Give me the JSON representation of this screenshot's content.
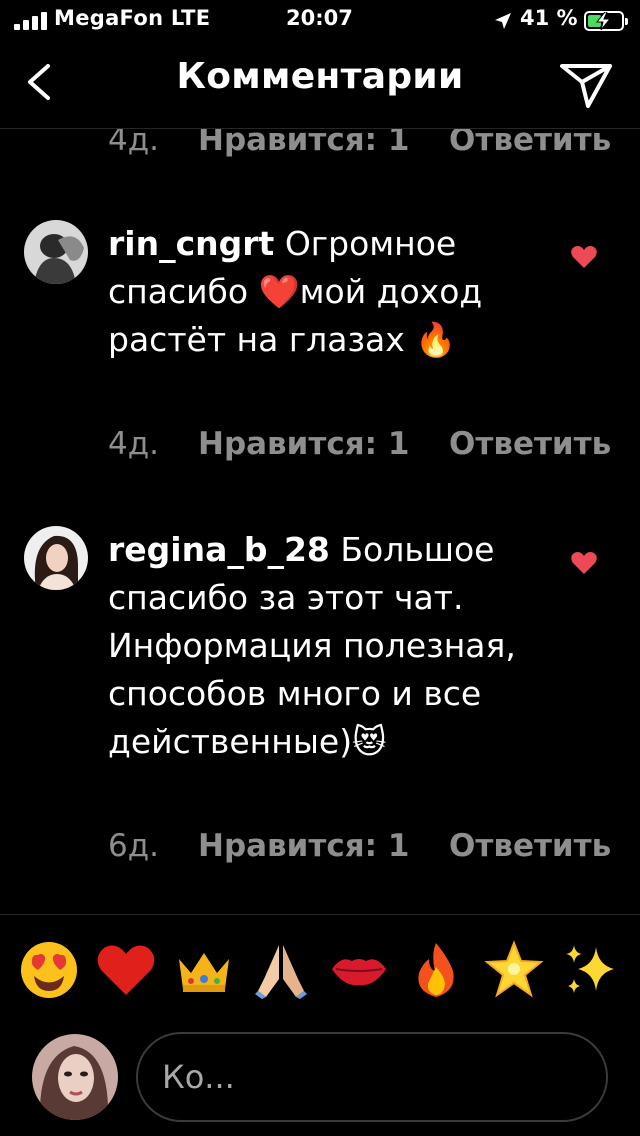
{
  "status_bar": {
    "carrier": "MegaFon LTE",
    "time": "20:07",
    "battery_percent": "41 %",
    "battery_level": 0.41
  },
  "header": {
    "title": "Комментарии",
    "back_icon": "chevron-left-icon",
    "share_icon": "paper-plane-icon"
  },
  "comments": [
    {
      "time": "4д.",
      "likes_label": "Нравится: 1",
      "reply_label": "Ответить"
    },
    {
      "username": "rin_cngrt",
      "text": "Огромное спасибо ❤️мой доход растёт на глазах 🔥",
      "time": "4д.",
      "likes_label": "Нравится: 1",
      "reply_label": "Ответить",
      "liked": true
    },
    {
      "username": "regina_b_28",
      "text": "Большое спасибо за этот чат. Информация полезная, способов много и все действенные)😻",
      "time": "6д.",
      "likes_label": "Нравится: 1",
      "reply_label": "Ответить",
      "liked": true
    }
  ],
  "emoji_bar": [
    "😍",
    "❤️",
    "👑",
    "🙏🏼",
    "💋",
    "🔥",
    "🌟",
    "✨"
  ],
  "composer": {
    "placeholder": "Ко..."
  },
  "colors": {
    "background": "#000000",
    "muted_text": "#8e8e8e",
    "heart_red": "#ed4956",
    "battery_green": "#4cd964"
  }
}
